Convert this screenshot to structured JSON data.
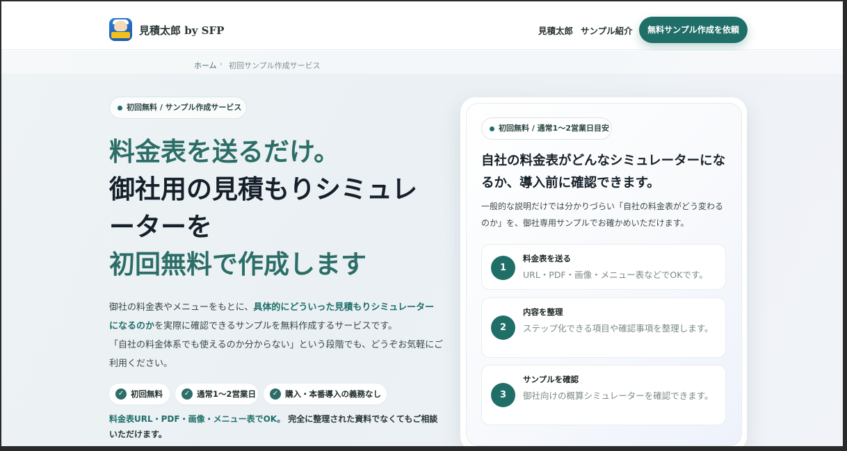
{
  "header": {
    "brand": "見積太郎 by SFP",
    "nav": [
      "見積太郎",
      "サンプル紹介"
    ],
    "cta": "無料サンプル作成を依頼"
  },
  "breadcrumb": {
    "home": "ホーム",
    "separator": "›",
    "current": "初回サンプル作成サービス"
  },
  "hero": {
    "pill": "初回無料 / サンプル作成サービス",
    "title_lines": [
      "料金表を送るだけ。",
      "御社用の見積もりシミュレ",
      "ーターを",
      "初回無料で作成します"
    ],
    "lead": {
      "p1_a": "御社の料金表やメニューをもとに、",
      "p1_hl": "具体的にどういった見積もりシミュレーターになるのか",
      "p1_b": "を実際に確認できるサンプルを無料作成するサービスです。",
      "p2": "「自社の料金体系でも使えるのか分からない」という段階でも、どうぞお気軽にご利用ください。"
    },
    "badges": [
      "初回無料",
      "通常1〜2営業日",
      "購入・本番導入の義務なし"
    ],
    "note_hl": "料金表URL・PDF・画像・メニュー表でOK。",
    "note_rest": "完全に整理された資料でなくてもご相談いただけます。"
  },
  "card": {
    "pill": "初回無料 / 通常1〜2営業日目安",
    "title": "自社の料金表がどんなシミュレーターになるか、導入前に確認できます。",
    "desc": "一般的な説明だけでは分かりづらい「自社の料金表がどう変わるのか」を、御社専用サンプルでお確かめいただけます。",
    "steps": [
      {
        "num": "1",
        "title": "料金表を送る",
        "text": "URL・PDF・画像・メニュー表などでOKです。"
      },
      {
        "num": "2",
        "title": "内容を整理",
        "text": "ステップ化できる項目や確認事項を整理します。"
      },
      {
        "num": "3",
        "title": "サンプルを確認",
        "text": "御社向けの概算シミュレーターを確認できます。"
      }
    ]
  },
  "icons": {
    "check": "check-circle-icon",
    "dot": "bullet-dot-icon",
    "logo": "app-logo-icon"
  },
  "colors": {
    "accent": "#1f6e68",
    "heading_teal": "#2c6e67",
    "heading_dark": "#16202a"
  }
}
